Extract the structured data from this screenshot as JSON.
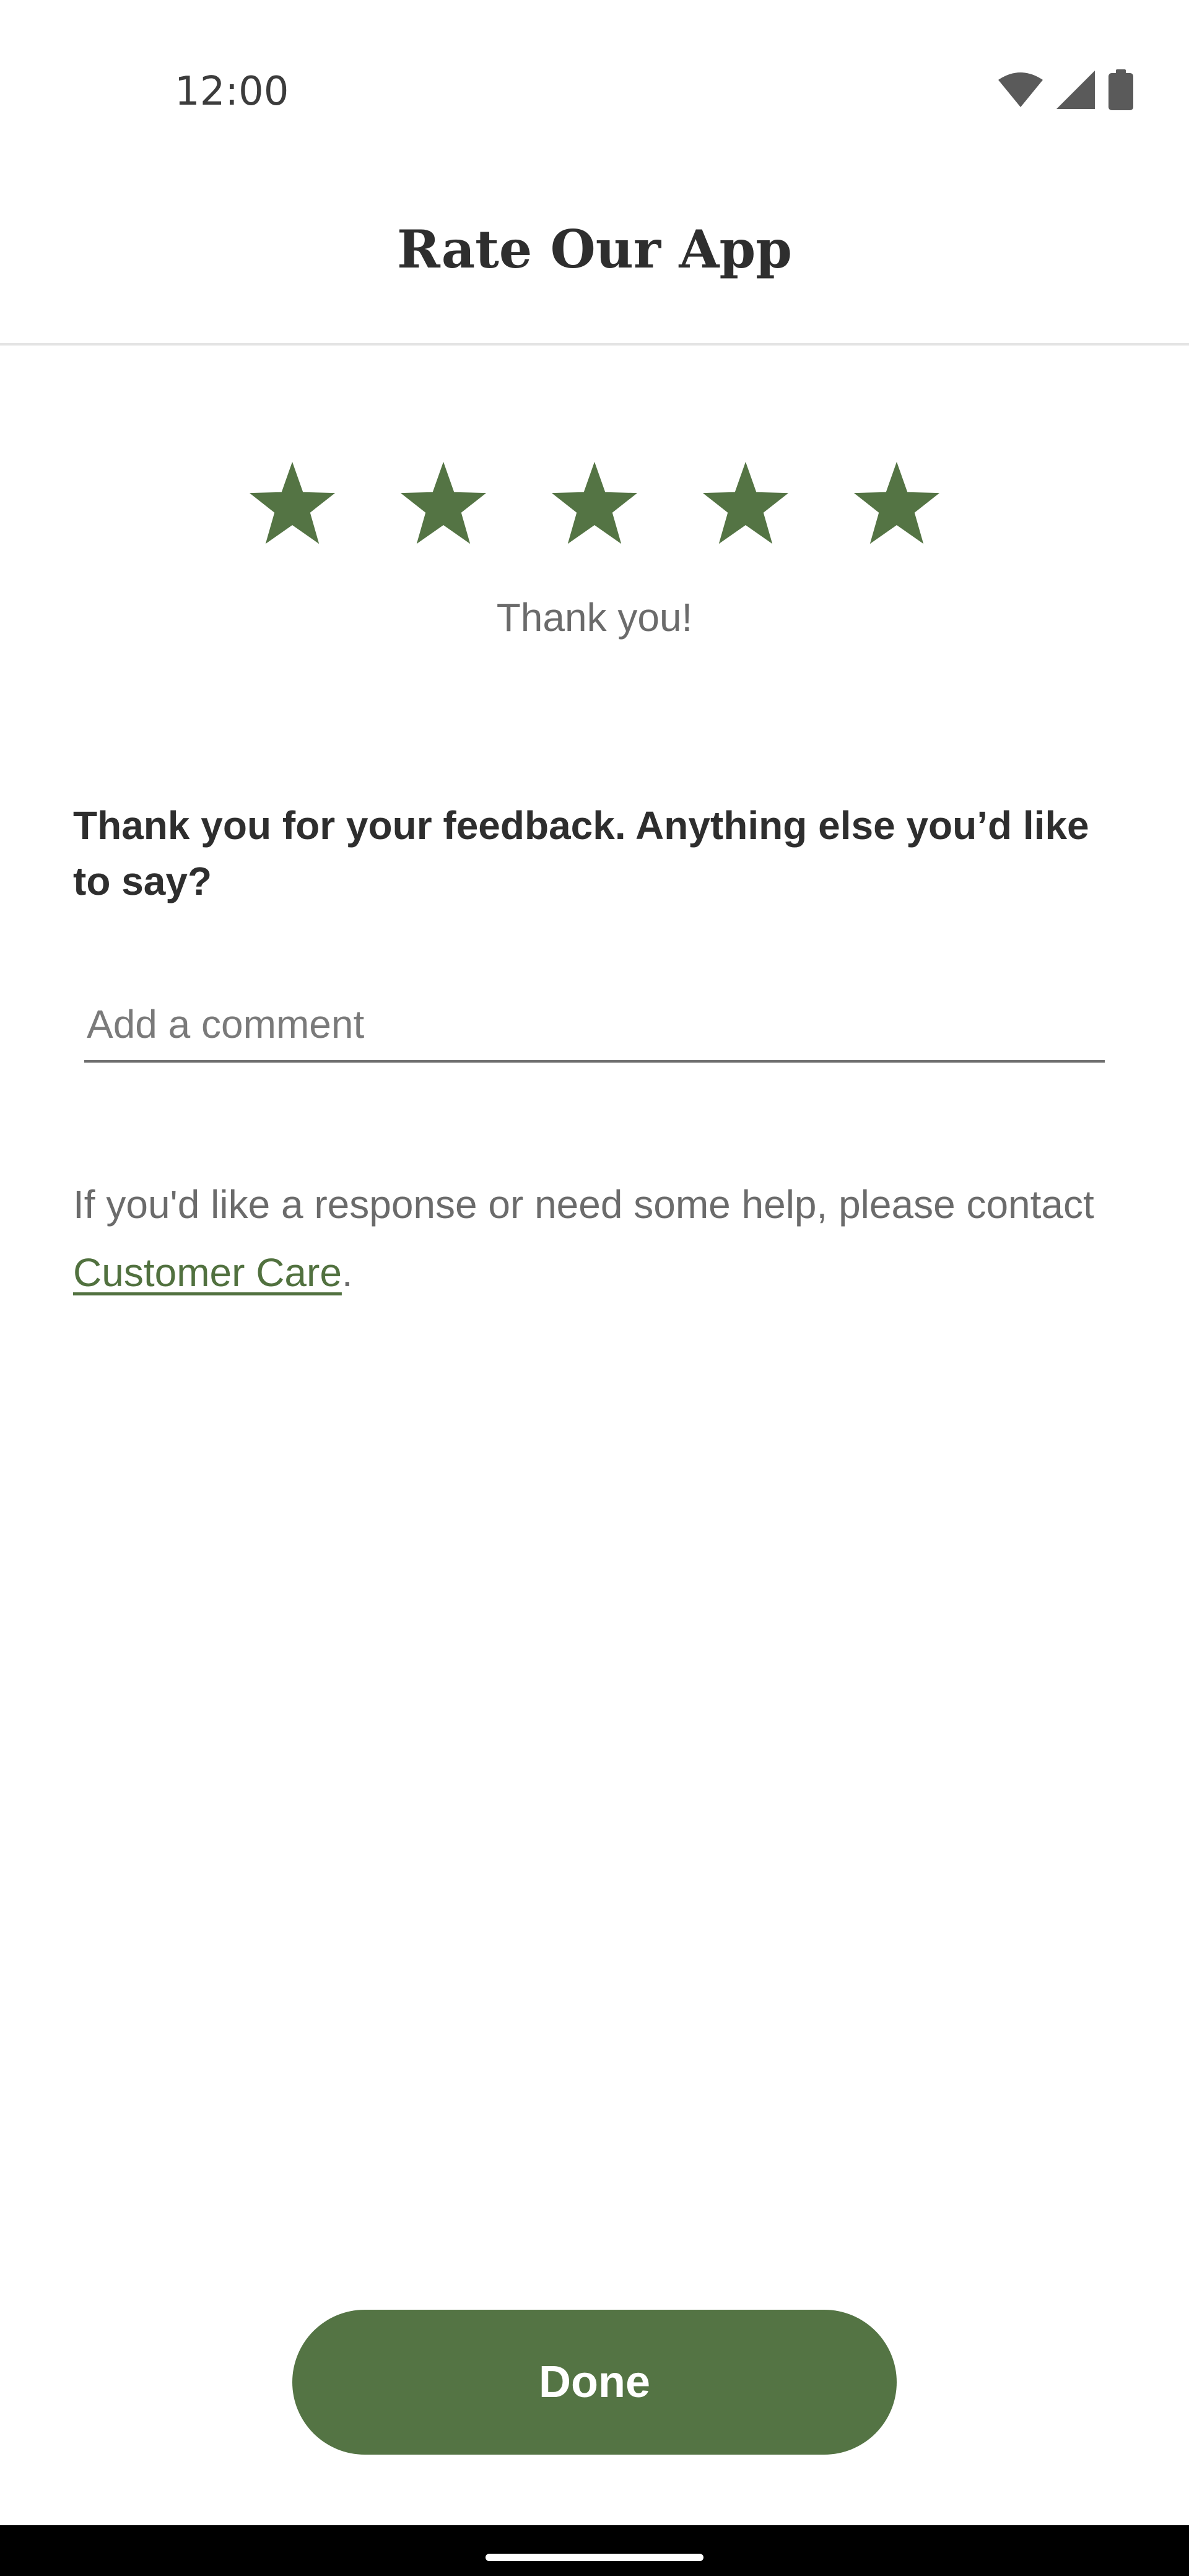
{
  "status_bar": {
    "time": "12:00",
    "icons": [
      "wifi-icon",
      "signal-icon",
      "battery-icon"
    ]
  },
  "header": {
    "title": "Rate Our App"
  },
  "rating": {
    "value": 5,
    "max": 5,
    "label": "Thank you!",
    "star_color": "#547444"
  },
  "feedback": {
    "prompt": "Thank you for your feedback. Anything else you’d like to say?",
    "comment_placeholder": "Add a comment",
    "comment_value": ""
  },
  "help": {
    "text_before": "If you'd like a response or need some help, please contact ",
    "link_label": "Customer Care",
    "text_after": "."
  },
  "actions": {
    "done_label": "Done"
  },
  "colors": {
    "accent": "#547444",
    "link": "#51713f",
    "text_primary": "#2e2e2e",
    "text_secondary": "#6b6b6b"
  }
}
